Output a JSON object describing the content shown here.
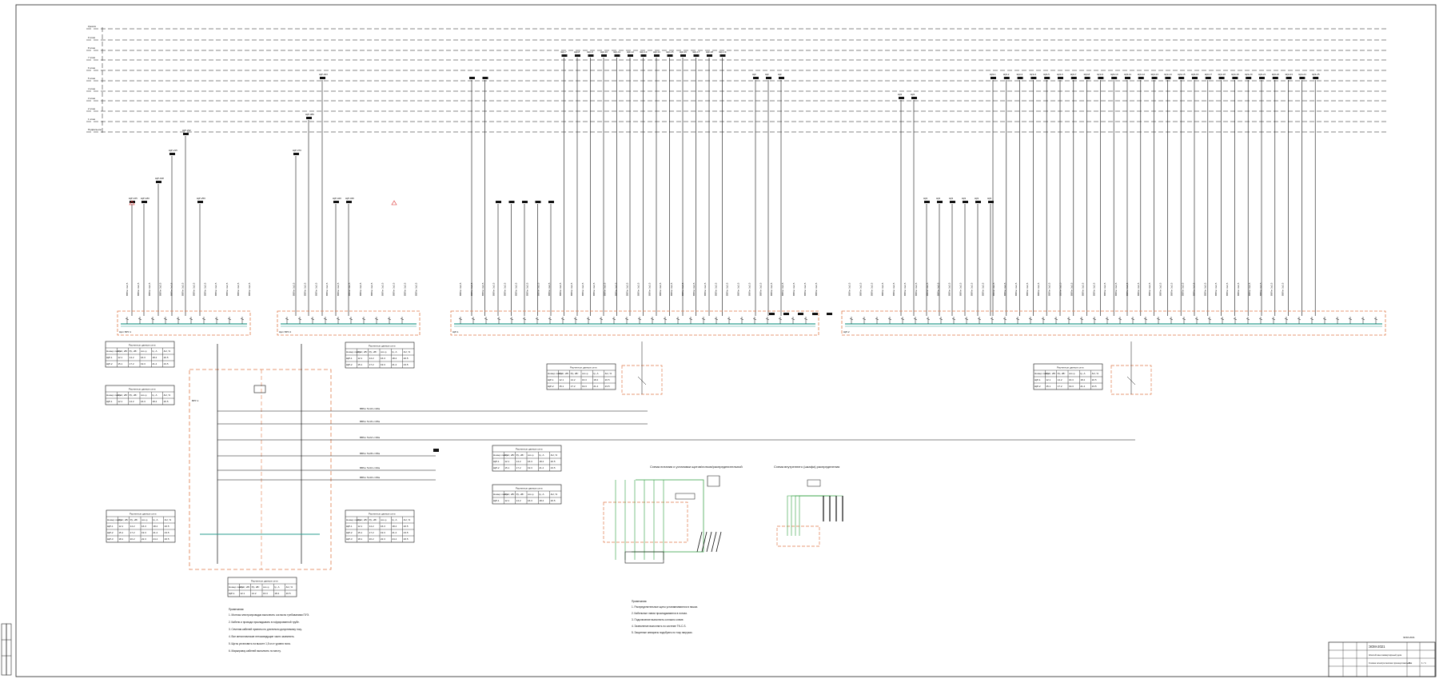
{
  "drawing": {
    "floor_labels": [
      "Кровля",
      "9 этаж",
      "8 этаж",
      "7 этаж",
      "6 этаж",
      "5 этаж",
      "4 этаж",
      "3 этаж",
      "2 этаж",
      "1 этаж",
      "Подвальное"
    ],
    "colors": {
      "line": "#111111",
      "dashed_box": "#e07a4a",
      "bus": "#2a9d8f",
      "green": "#2e9e3e",
      "purple": "#8a4ac2",
      "frame": "#222222"
    },
    "switchboards": [
      "Щит ВРУ-1",
      "Щит ВРУ-2",
      "ЩР-1",
      "ЩР-2",
      "ЩО-1"
    ],
    "schemes": {
      "scheme1_title": "Схема питания и установки щитов/лотков/распределительной",
      "scheme2_title": "Схема внутреннего (шкафа) распределения"
    },
    "tables": {
      "header": "Расчетные данные сети",
      "subheader": "Расчетные показатели",
      "cols": [
        "Номер линии",
        "Руст, кВт",
        "Рр, кВт",
        "cos φ",
        "Ip, А",
        "ΔU, %"
      ]
    },
    "notes": {
      "heading": "Примечания:",
      "left": [
        "1. Монтаж электропроводки выполнить согласно требованиям ПУЭ.",
        "2. Кабели и провода прокладывать в гофрированной трубе.",
        "3. Сечения кабелей приняты по длительно допустимому току.",
        "4. Все металлические нетоковедущие части заземлить.",
        "5. Щиты установить на высоте 1,5 м от уровня пола.",
        "6. Маркировку кабелей выполнить по месту."
      ],
      "center": [
        "1. Распределительные щиты устанавливаются в нишах.",
        "2. Кабельные линии прокладываются в лотках.",
        "3. Подключение выполнить согласно схеме.",
        "4. Заземление выполнить по системе TN-C-S.",
        "5. Защитные аппараты подобрать по току нагрузки."
      ]
    },
    "stamp": {
      "code": "ЭОМ-2021",
      "object": "Жилой многоквартирный дом",
      "sheet_name": "Схема электрическая принципиальная",
      "stage": "Р",
      "sheet": "1",
      "sheets": "1"
    }
  }
}
